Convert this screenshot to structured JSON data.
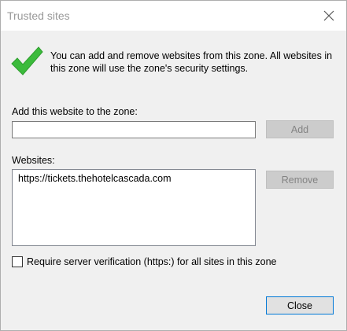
{
  "dialog": {
    "title": "Trusted sites",
    "info_text": "You can add and remove websites from this zone. All websites in this zone will use the zone's security settings.",
    "add_label": "Add this website to the zone:",
    "add_input_value": "",
    "add_button": "Add",
    "websites_label": "Websites:",
    "websites": [
      "https://tickets.thehotelcascada.com"
    ],
    "remove_button": "Remove",
    "require_https_label": "Require server verification (https:) for all sites in this zone",
    "require_https_checked": false,
    "close_button": "Close"
  },
  "icons": {
    "info_icon": "green-checkmark-icon",
    "close_icon": "close-icon"
  },
  "colors": {
    "check_green": "#3cbb3c",
    "focus_blue": "#0078d7"
  }
}
